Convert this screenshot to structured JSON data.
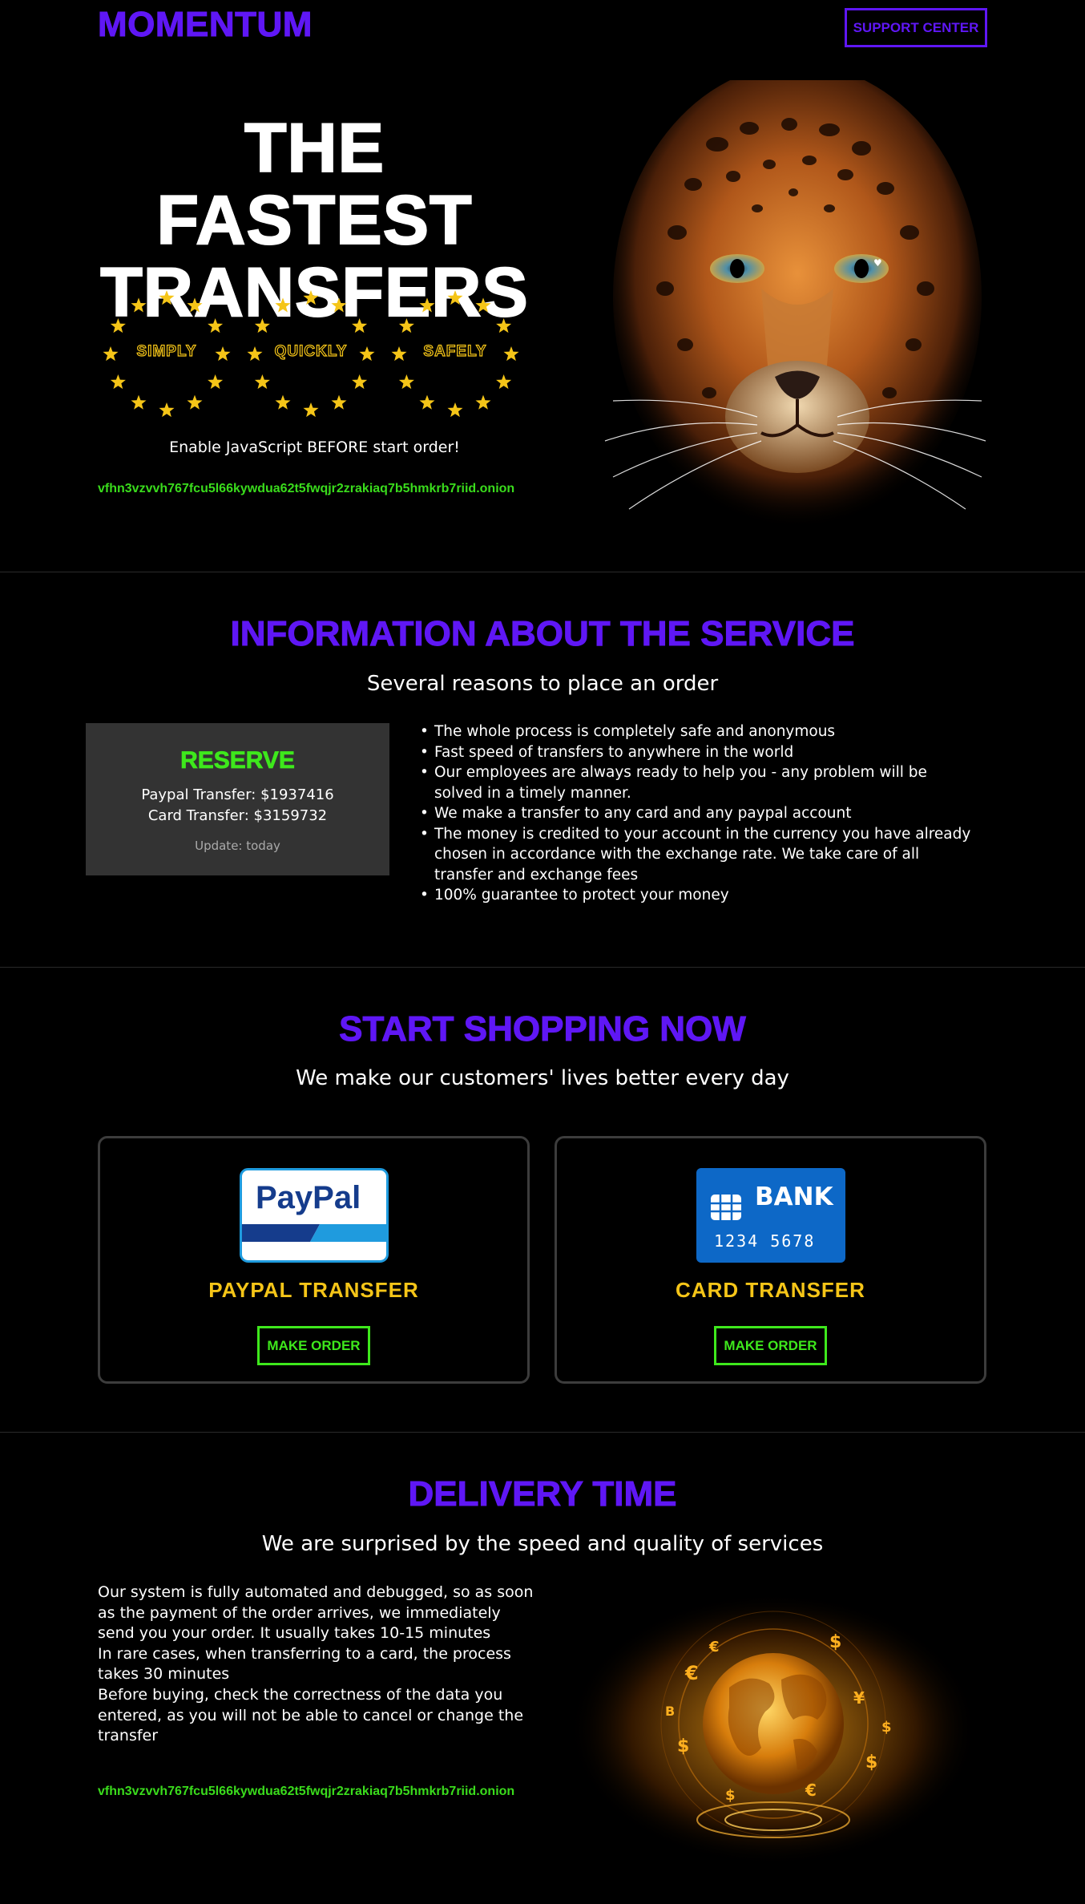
{
  "header": {
    "logo": "MOMENTUM",
    "support_label": "SUPPORT CENTER"
  },
  "hero": {
    "title_line1": "THE FASTEST",
    "title_line2": "TRANSFERS",
    "badges": [
      "SIMPLY",
      "QUICKLY",
      "SAFELY"
    ],
    "js_note": "Enable JavaScript BEFORE start order!",
    "onion": "vfhn3vzvvh767fcu5l66kywdua62t5fwqjr2zrakiaq7b5hmkrb7riid.onion"
  },
  "info": {
    "title": "INFORMATION ABOUT THE SERVICE",
    "subtitle": "Several reasons to place an order",
    "reserve": {
      "title": "RESERVE",
      "paypal": "Paypal Transfer: $1937416",
      "card": "Card Transfer: $3159732",
      "update": "Update: today"
    },
    "reasons": [
      "The whole process is completely safe and anonymous",
      "Fast speed of transfers to anywhere in the world",
      "Our employees are always ready to help you - any problem will be solved in a timely manner.",
      "We make a transfer to any card and any paypal account",
      "The money is credited to your account in the currency you have already chosen in accordance with the exchange rate. We take care of all transfer and exchange fees",
      "100% guarantee to protect your money"
    ]
  },
  "shop": {
    "title": "START SHOPPING NOW",
    "subtitle": "We make our customers' lives better every day",
    "cards": [
      {
        "title": "PAYPAL TRANSFER",
        "button": "MAKE ORDER",
        "logo_text": "PayPal"
      },
      {
        "title": "CARD TRANSFER",
        "button": "MAKE ORDER",
        "logo_text": "BANK",
        "card_number": "1234 5678"
      }
    ]
  },
  "delivery": {
    "title": "DELIVERY TIME",
    "subtitle": "We are surprised by the speed and quality of services",
    "text": "Our system is fully automated and debugged, so as soon as the payment of the order arrives, we immediately send you your order. It usually takes 10-15 minutes\nIn rare cases, when transferring to a card, the process takes 30 minutes\nBefore buying, check the correctness of the data you entered, as you will not be able to cancel or change the transfer",
    "onion": "vfhn3vzvvh767fcu5l66kywdua62t5fwqjr2zrakiaq7b5hmkrb7riid.onion"
  },
  "colors": {
    "brand": "#5f17f5",
    "accent_green": "#3ee81c",
    "gold": "#f5c518",
    "background": "#000000"
  }
}
